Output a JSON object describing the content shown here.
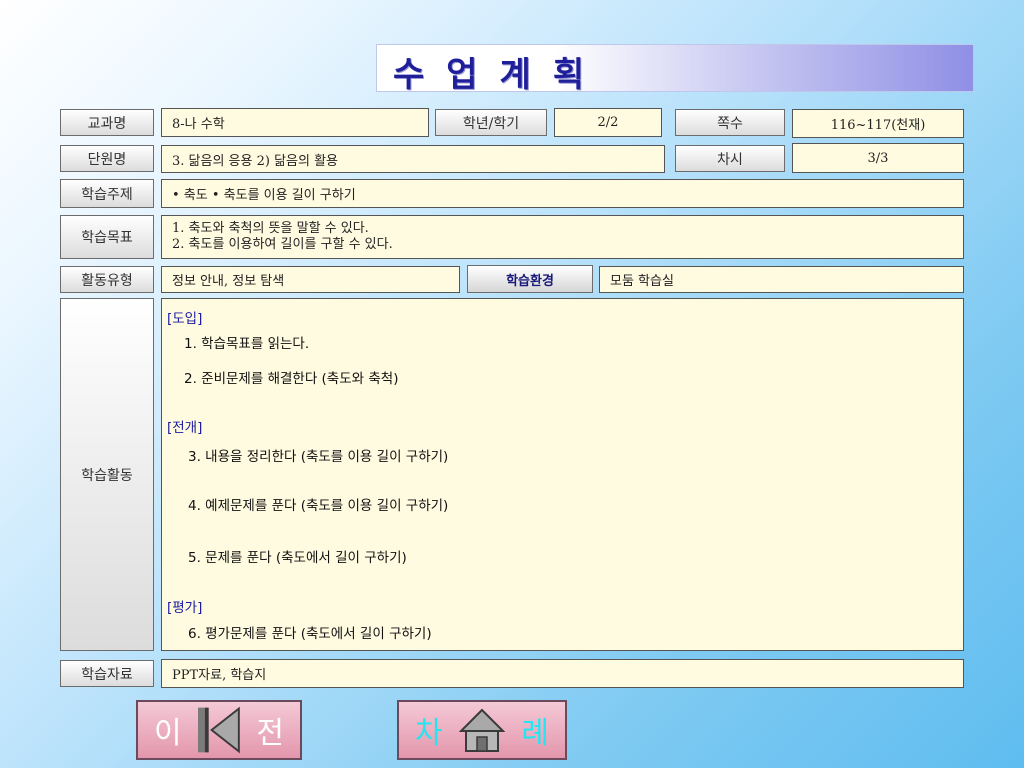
{
  "header": {
    "title": "수업계획"
  },
  "rows": {
    "subject": {
      "label": "교과명",
      "value": "8-나  수학"
    },
    "grade": {
      "label": "학년/학기",
      "value": "2/2"
    },
    "pages": {
      "label": "쪽수",
      "value": "116~117(천재)"
    },
    "unit": {
      "label": "단원명",
      "value": "3. 닮음의 응용        2) 닮음의 활용"
    },
    "session": {
      "label": "차시",
      "value": "3/3"
    },
    "topic": {
      "label": "학습주제",
      "value": "• 축도    • 축도를 이용 길이 구하기"
    },
    "goals": {
      "label": "학습목표",
      "line1": "1. 축도와 축척의 뜻을 말할 수 있다.",
      "line2": "2. 축도를 이용하여 길이를 구할 수 있다."
    },
    "activity_type": {
      "label": "활동유형",
      "value": "정보 안내, 정보 탐색"
    },
    "environment": {
      "label": "학습환경",
      "value": "모둠 학습실"
    },
    "activities": {
      "label": "학습활동",
      "intro_heading": "[도입]",
      "step1": "1. 학습목표를 읽는다.",
      "step2": "2. 준비문제를 해결한다 (축도와 축척)",
      "develop_heading": "[전개]",
      "step3": "3. 내용을 정리한다 (축도를 이용 길이 구하기)",
      "step4": "4. 예제문제를 푼다 (축도를 이용 길이 구하기)",
      "step5": "5. 문제를 푼다 (축도에서 길이 구하기)",
      "eval_heading": "[평가]",
      "step6": "6. 평가문제를 푼다 (축도에서 길이 구하기)"
    },
    "materials": {
      "label": "학습자료",
      "value": "PPT자료, 학습지"
    }
  },
  "nav": {
    "prev": {
      "left_char": "이",
      "right_char": "전",
      "icon": "left-triangle-icon"
    },
    "toc": {
      "left_char": "차",
      "right_char": "례",
      "icon": "home-icon"
    }
  },
  "colors": {
    "title_text": "#1f1f9a",
    "field_bg": "#fffbe0",
    "heading_blue": "#1a1aa0",
    "button_pink": "#e396ac",
    "toc_text_cyan": "#23e6f2"
  }
}
